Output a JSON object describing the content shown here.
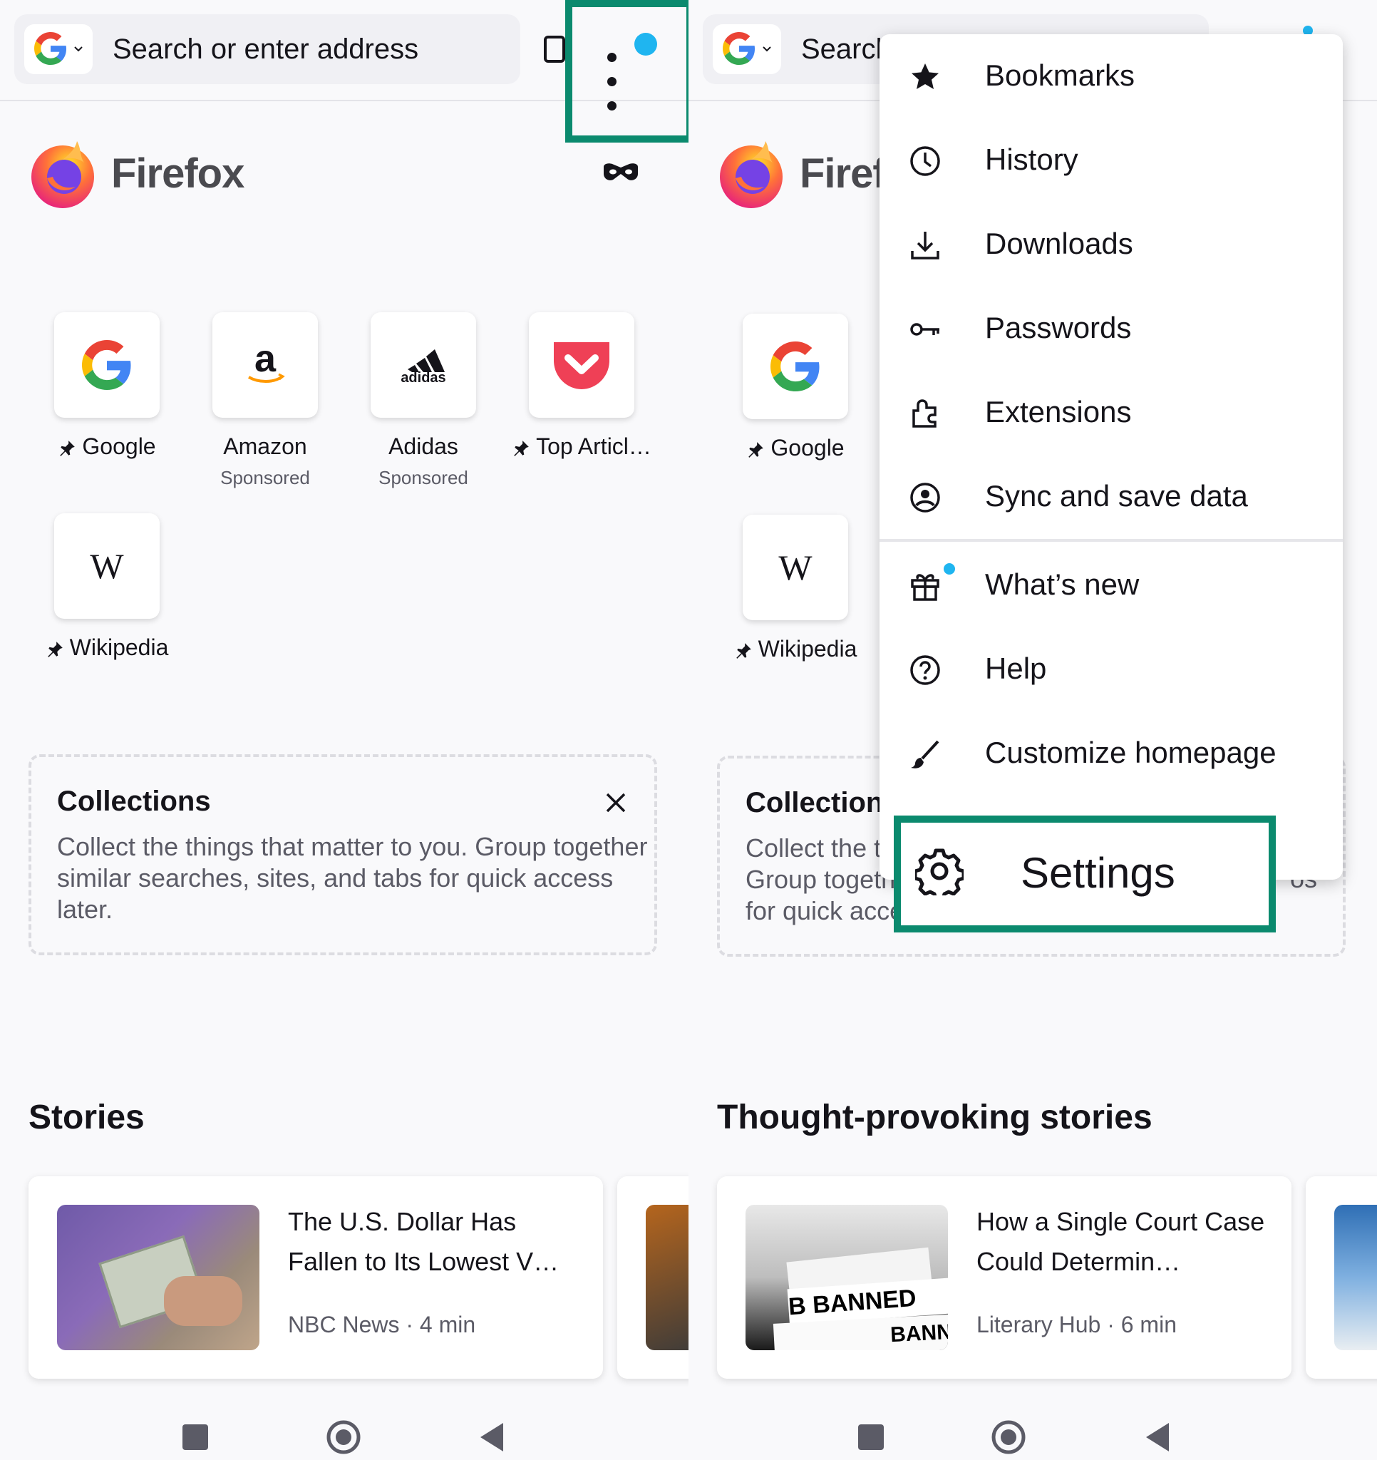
{
  "left": {
    "urlbar": {
      "placeholder": "Search or enter address"
    },
    "brand": "Firefox",
    "shortcuts": [
      {
        "name": "Google",
        "pinned": true,
        "sponsored": ""
      },
      {
        "name": "Amazon",
        "pinned": false,
        "sponsored": "Sponsored"
      },
      {
        "name": "Adidas",
        "pinned": false,
        "sponsored": "Sponsored"
      },
      {
        "name": "Top Articl…",
        "pinned": true,
        "sponsored": ""
      },
      {
        "name": "Wikipedia",
        "pinned": true,
        "sponsored": ""
      }
    ],
    "collections": {
      "title": "Collections",
      "description": "Collect the things that matter to you. Group together similar searches, sites, and tabs for quick access later."
    },
    "stories": {
      "title": "Stories",
      "cards": [
        {
          "headline": "The U.S. Dollar Has Fallen to Its Lowest V…",
          "source": "NBC News",
          "read_time": "4 min"
        }
      ]
    }
  },
  "right": {
    "urlbar": {
      "placeholder": "Search"
    },
    "brand": "Firefox",
    "shortcuts": [
      {
        "name": "Google",
        "pinned": true
      },
      {
        "name": "Wikipedia",
        "pinned": true
      }
    ],
    "collections": {
      "title": "Collections",
      "line1": "Collect the th",
      "line2": "Group togethe",
      "line3": "for quick acce",
      "tail": "os"
    },
    "stories": {
      "title": "Thought-provoking stories",
      "cards": [
        {
          "headline": "How a Single Court Case Could Determin…",
          "source": "Literary Hub",
          "read_time": "6 min"
        }
      ]
    }
  },
  "menu": {
    "items": [
      {
        "label": "Bookmarks",
        "icon": "star-icon"
      },
      {
        "label": "History",
        "icon": "clock-icon"
      },
      {
        "label": "Downloads",
        "icon": "download-icon"
      },
      {
        "label": "Passwords",
        "icon": "key-icon"
      },
      {
        "label": "Extensions",
        "icon": "puzzle-icon"
      },
      {
        "label": "Sync and save data",
        "icon": "account-icon"
      },
      {
        "label": "What’s new",
        "icon": "gift-icon"
      },
      {
        "label": "Help",
        "icon": "help-icon"
      },
      {
        "label": "Customize homepage",
        "icon": "brush-icon"
      }
    ],
    "settings": {
      "label": "Settings",
      "icon": "gear-icon"
    }
  },
  "colors": {
    "highlight": "#0b8a6e",
    "notification_dot": "#1fb5f0",
    "background": "#f9f9fb"
  }
}
